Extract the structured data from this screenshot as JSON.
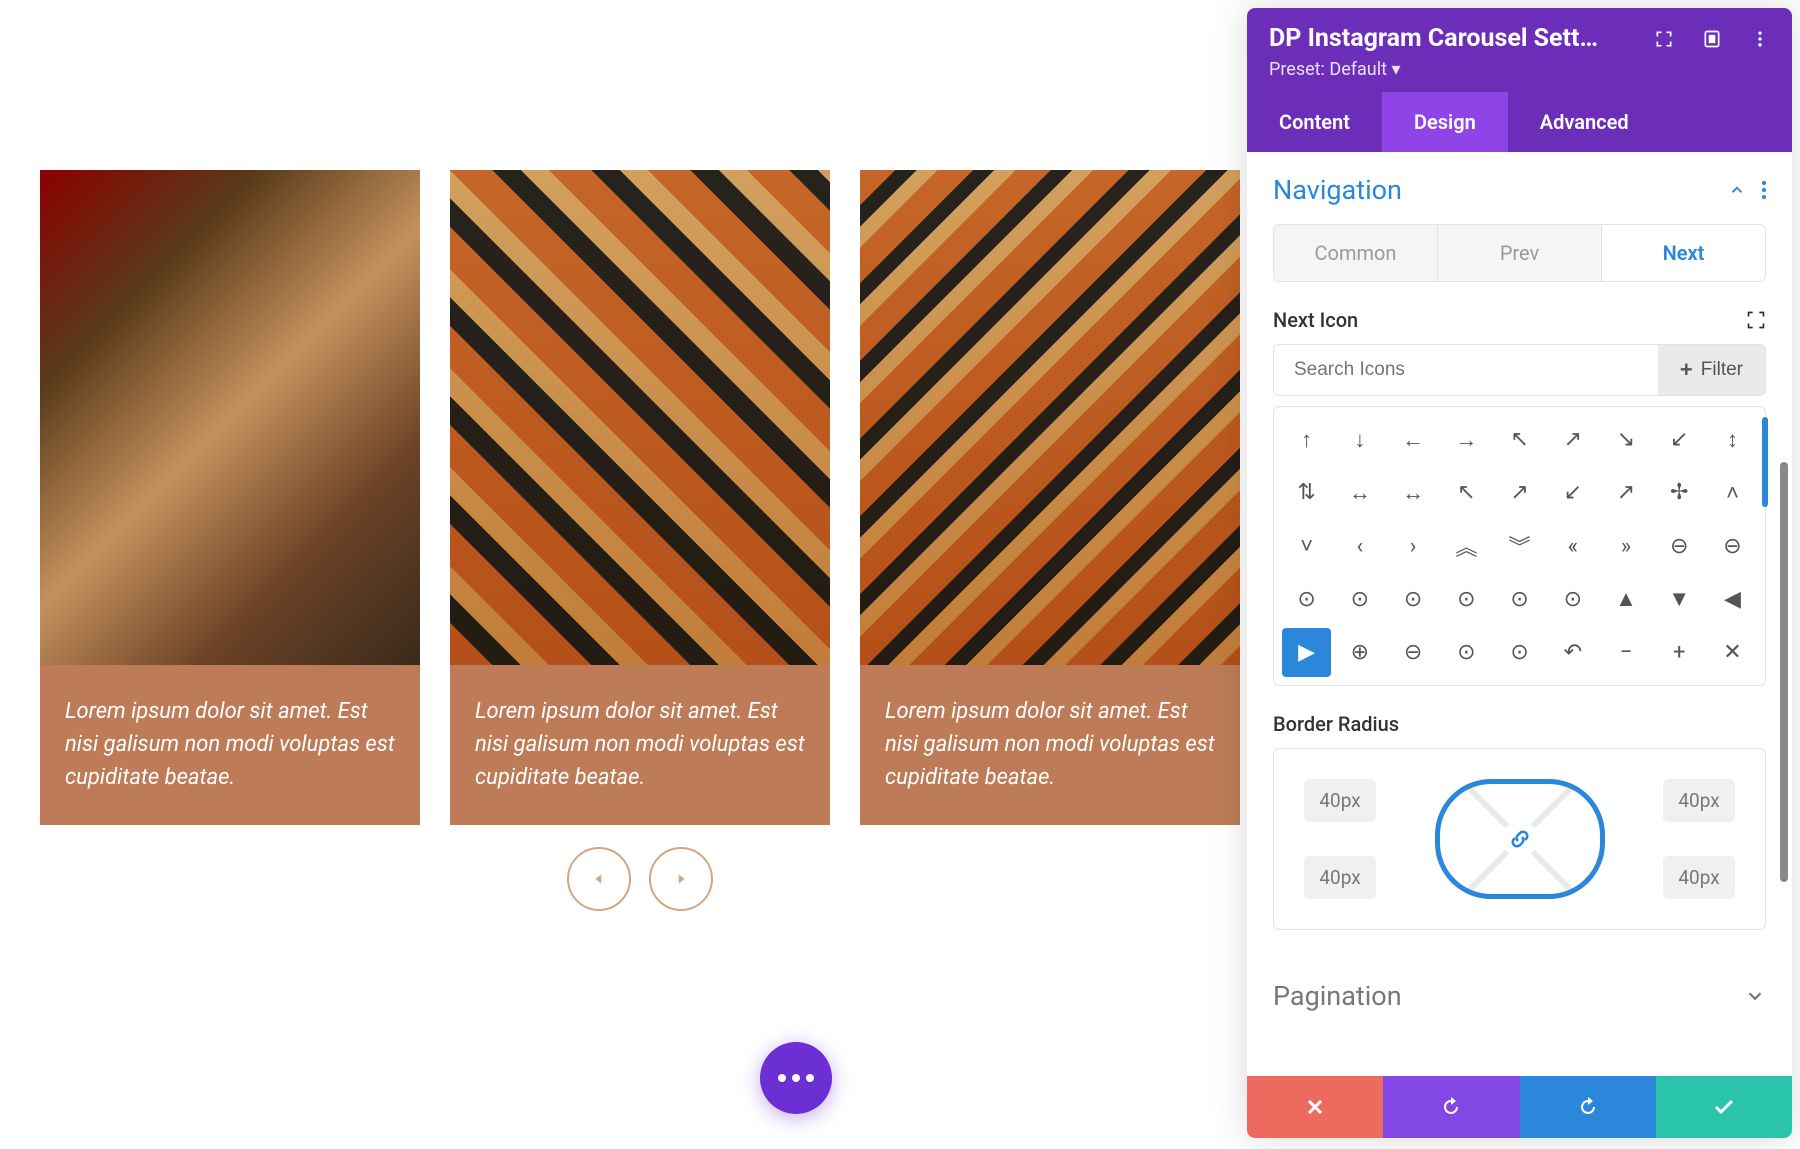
{
  "carousel": {
    "cards": [
      {
        "caption": "Lorem ipsum dolor sit amet. Est nisi galisum non modi voluptas est cupiditate beatae."
      },
      {
        "caption": "Lorem ipsum dolor sit amet. Est nisi galisum non modi voluptas est cupiditate beatae."
      },
      {
        "caption": "Lorem ipsum dolor sit amet. Est nisi galisum non modi voluptas est cupiditate beatae."
      }
    ]
  },
  "panel": {
    "title": "DP Instagram Carousel Sett…",
    "preset": "Preset: Default",
    "tabs": [
      "Content",
      "Design",
      "Advanced"
    ],
    "active_tab": "Design",
    "section": {
      "title": "Navigation",
      "subtabs": [
        "Common",
        "Prev",
        "Next"
      ],
      "active_subtab": "Next"
    },
    "next_icon": {
      "label": "Next Icon",
      "search_placeholder": "Search Icons",
      "filter_label": "Filter",
      "icons": [
        "↑",
        "↓",
        "←",
        "→",
        "↖",
        "↗",
        "↘",
        "↙",
        "↕",
        "⇅",
        "↔",
        "↔",
        "↖",
        "↗",
        "↙",
        "↗",
        "✢",
        "˄",
        "˅",
        "‹",
        "›",
        "︽",
        "︾",
        "«",
        "»",
        "⊖",
        "⊖",
        "⊙",
        "⊙",
        "⊙",
        "⊙",
        "⊙",
        "⊙",
        "▲",
        "▼",
        "◀",
        "▶",
        "⊕",
        "⊖",
        "⊙",
        "⊙",
        "↶",
        "−",
        "+",
        "✕"
      ],
      "selected_index": 36
    },
    "border_radius": {
      "label": "Border Radius",
      "tl": "40px",
      "tr": "40px",
      "bl": "40px",
      "br": "40px"
    },
    "pagination": {
      "title": "Pagination"
    }
  }
}
